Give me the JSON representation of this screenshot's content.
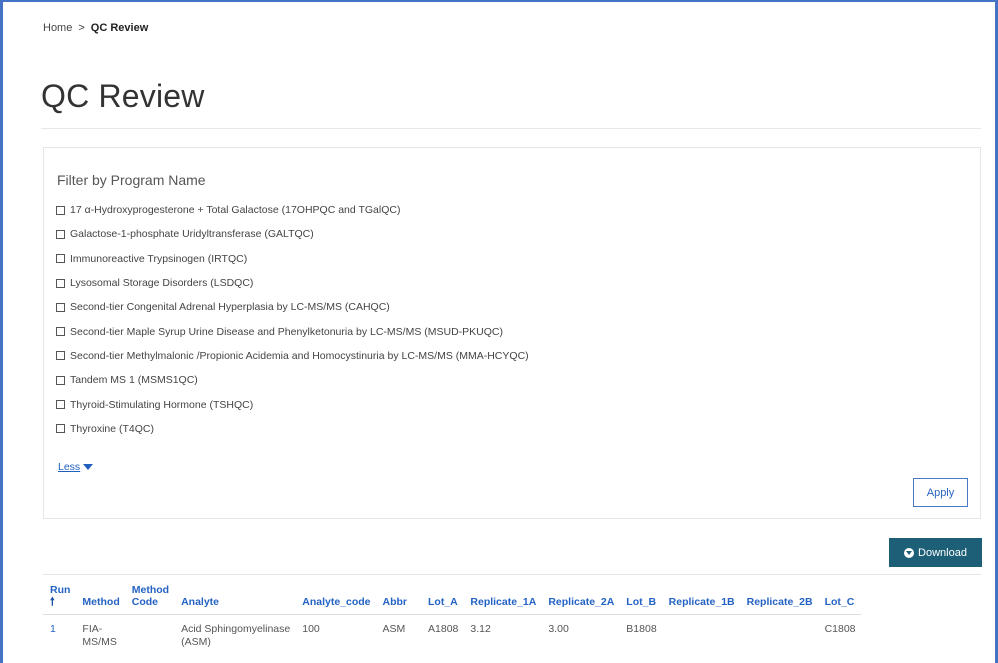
{
  "breadcrumb": {
    "home": "Home",
    "separator": ">",
    "current": "QC Review"
  },
  "page": {
    "title": "QC Review"
  },
  "filter": {
    "heading": "Filter by Program Name",
    "options": [
      "17 α-Hydroxyprogesterone + Total Galactose (17OHPQC and TGalQC)",
      "Galactose-1-phosphate Uridyltransferase (GALTQC)",
      "Immunoreactive Trypsinogen (IRTQC)",
      "Lysosomal Storage Disorders (LSDQC)",
      "Second-tier Congenital Adrenal Hyperplasia by LC-MS/MS (CAHQC)",
      "Second-tier Maple Syrup Urine Disease and Phenylketonuria by LC-MS/MS (MSUD-PKUQC)",
      "Second-tier Methylmalonic /Propionic Acidemia and Homocystinuria by LC-MS/MS (MMA-HCYQC)",
      "Tandem MS 1 (MSMS1QC)",
      "Thyroid-Stimulating Hormone (TSHQC)",
      "Thyroxine (T4QC)"
    ],
    "less_label": "Less",
    "apply_label": "Apply"
  },
  "toolbar": {
    "download_label": "Download",
    "download_icon": "download-circle-icon"
  },
  "table": {
    "headers": {
      "run": "Run",
      "sort_arrow": "🠕",
      "method": "Method",
      "method_code_1": "Method",
      "method_code_2": "Code",
      "analyte": "Analyte",
      "analyte_code": "Analyte_code",
      "abbr": "Abbr",
      "lot_a": "Lot_A",
      "replicate_1a": "Replicate_1A",
      "replicate_2a": "Replicate_2A",
      "lot_b": "Lot_B",
      "replicate_1b": "Replicate_1B",
      "replicate_2b": "Replicate_2B",
      "lot_c": "Lot_C"
    },
    "rows": [
      {
        "run": "1",
        "method_1": "FIA-",
        "method_2": "MS/MS",
        "method_code": "",
        "analyte_1": "Acid Sphingomyelinase",
        "analyte_2": "(ASM)",
        "analyte_code": "100",
        "abbr": "ASM",
        "lot_a": "A1808",
        "replicate_1a": "3.12",
        "replicate_2a": "3.00",
        "lot_b": "B1808",
        "replicate_1b": "",
        "replicate_2b": "",
        "lot_c": "C1808"
      }
    ]
  },
  "colors": {
    "accent": "#2463c4",
    "download_bg": "#1e5f78",
    "frame": "#4472c4"
  }
}
